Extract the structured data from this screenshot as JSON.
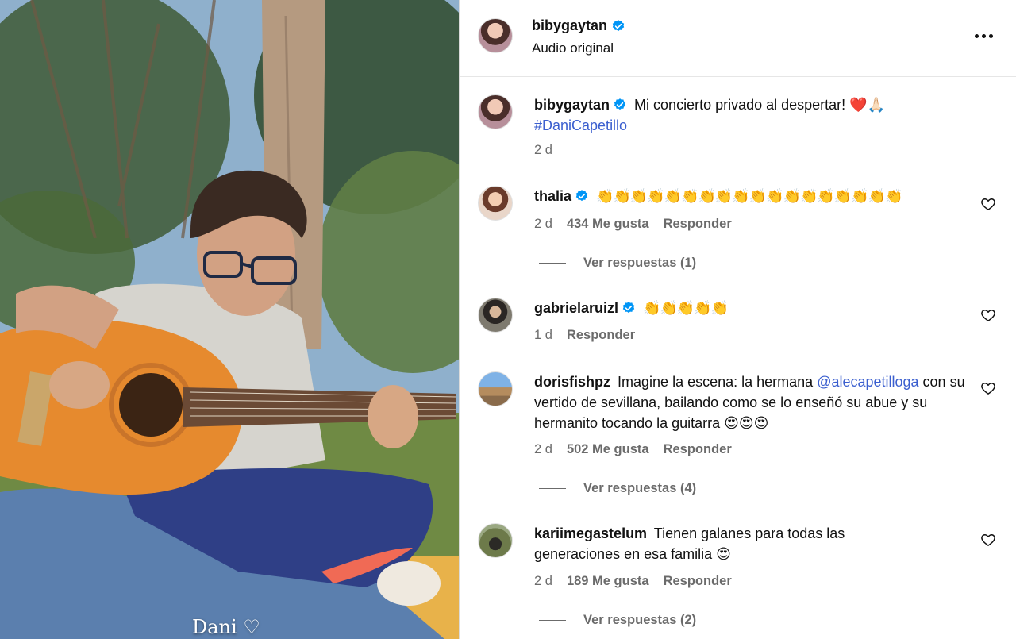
{
  "media": {
    "caption": "Dani ♡"
  },
  "post": {
    "username": "bibygaytan",
    "audio_label": "Audio original",
    "more_label": "…",
    "caption_text": "Mi concierto privado al despertar! ❤️🙏🏻",
    "hashtag": "#DaniCapetillo",
    "age": "2 d"
  },
  "comments": [
    {
      "username": "thalia",
      "verified": true,
      "text": "👏👏👏👏👏👏👏👏👏👏👏👏👏👏👏👏👏👏",
      "age": "2 d",
      "likes": "434 Me gusta",
      "reply_label": "Responder",
      "view_replies": "Ver respuestas (1)"
    },
    {
      "username": "gabrielaruizl",
      "verified": true,
      "text": "👏👏👏👏👏",
      "age": "1 d",
      "reply_label": "Responder"
    },
    {
      "username": "dorisfishpz",
      "verified": false,
      "text_before": "Imagine la escena: la hermana ",
      "mention": "@alecapetilloga",
      "text_after": " con su vertido de sevillana, bailando como se lo enseñó su abue y su hermanito tocando la guitarra 😍😍😍",
      "age": "2 d",
      "likes": "502 Me gusta",
      "reply_label": "Responder",
      "view_replies": "Ver respuestas (4)"
    },
    {
      "username": "kariimegastelum",
      "verified": false,
      "text": "Tienen galanes para todas las generaciones en esa familia 😍",
      "age": "2 d",
      "likes": "189 Me gusta",
      "reply_label": "Responder",
      "view_replies": "Ver respuestas (2)"
    }
  ],
  "icons": {
    "verified": "verified-badge-icon",
    "heart": "heart-outline-icon",
    "more": "more-horizontal-icon"
  },
  "colors": {
    "verified_blue": "#0095f6",
    "link_blue": "#3b5fcf",
    "muted_text": "#6b6b6b"
  }
}
